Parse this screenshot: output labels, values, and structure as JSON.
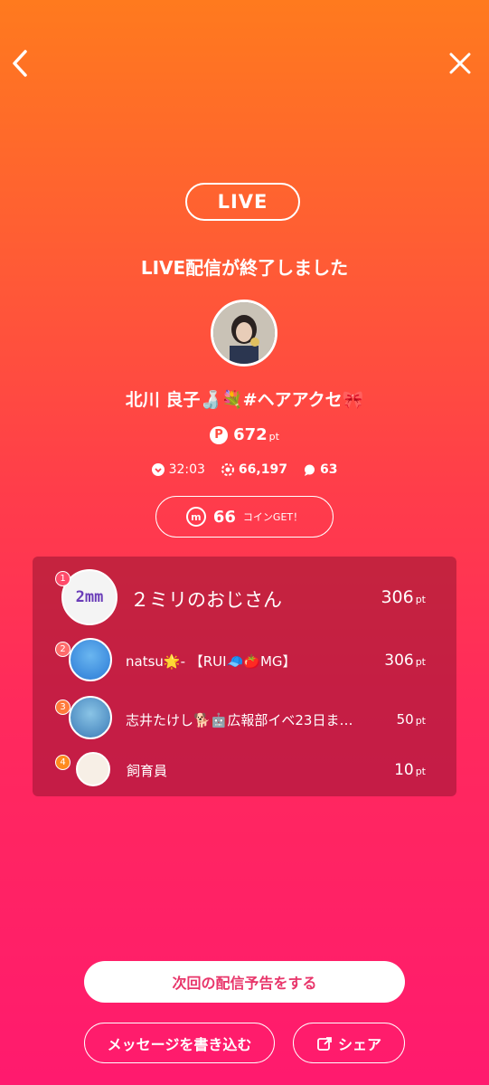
{
  "header": {
    "back_icon": "chevron-left-icon",
    "close_icon": "close-icon"
  },
  "badge": "LIVE",
  "ended_title": "LIVE配信が終了しました",
  "streamer": {
    "name": "北川 良子🍶💐#ヘアアクセ🎀"
  },
  "points": {
    "icon_label": "P",
    "value": "672",
    "unit": "pt"
  },
  "stats": {
    "duration": "32:03",
    "viewers": "66,197",
    "comments": "63"
  },
  "coin": {
    "icon_label": "m",
    "amount": "66",
    "label": "コインGET！"
  },
  "ranking": [
    {
      "rank": "1",
      "name": "２ミリのおじさん",
      "points": "306",
      "unit": "pt",
      "avatar_text": "2mm",
      "rank_color": "#ff4a6a"
    },
    {
      "rank": "2",
      "name": "natsu🌟- 【RUI🧢🍅MG】",
      "points": "306",
      "unit": "pt",
      "rank_color": "#ff6b6b"
    },
    {
      "rank": "3",
      "name": "志井たけし🐕🤖広報部イベ23日ま…",
      "points": "50",
      "unit": "pt",
      "rank_color": "#ff7a3a"
    },
    {
      "rank": "4",
      "name": "飼育員",
      "points": "10",
      "unit": "pt",
      "rank_color": "#ff8a1e"
    }
  ],
  "buttons": {
    "schedule": "次回の配信予告をする",
    "message": "メッセージを書き込む",
    "share": "シェア"
  }
}
